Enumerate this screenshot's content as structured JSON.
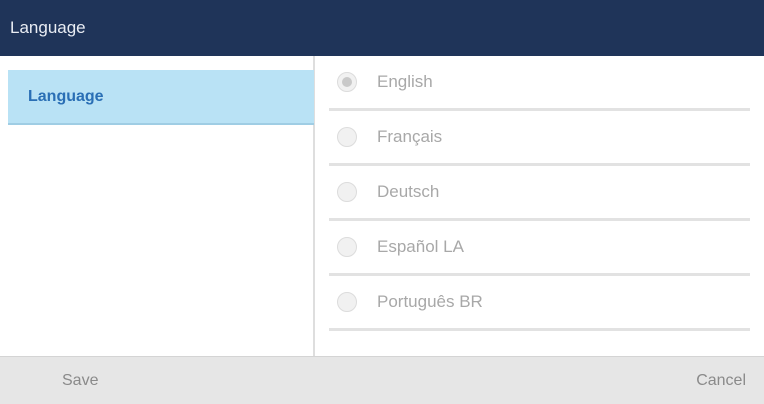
{
  "window": {
    "title": "Language"
  },
  "sidebar": {
    "items": [
      {
        "label": "Language",
        "selected": true
      }
    ]
  },
  "options": {
    "items": [
      {
        "label": "English",
        "selected": true
      },
      {
        "label": "Français",
        "selected": false
      },
      {
        "label": "Deutsch",
        "selected": false
      },
      {
        "label": "Español LA",
        "selected": false
      },
      {
        "label": "Português BR",
        "selected": false
      }
    ]
  },
  "softkeys": {
    "save": "Save",
    "cancel": "Cancel"
  },
  "colors": {
    "title_bar": "#1f3459",
    "sidebar_selected": "#b9e2f5",
    "sidebar_selected_text": "#2a6fb5",
    "bottom_bar": "#e6e6e6"
  }
}
